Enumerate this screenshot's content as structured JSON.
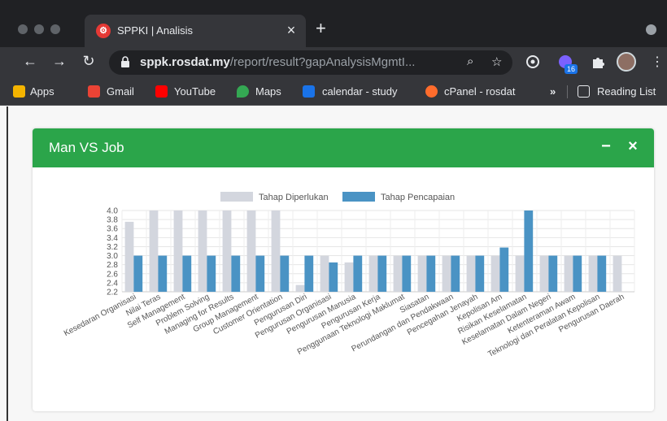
{
  "browser": {
    "tab": {
      "title": "SPPKI | Analisis",
      "favicon_letter": "⚙",
      "close": "×"
    },
    "new_tab": "+",
    "nav": {
      "back": "←",
      "forward": "→",
      "reload": "↻"
    },
    "address": {
      "host": "sppk.rosdat.my",
      "path": "/report/result?gapAnalysisMgmtI..."
    },
    "extension_badge": "16",
    "menu": "⋮",
    "bookmarks": [
      {
        "label": "Apps",
        "icon": "apps-grid-icon",
        "color": "#f4b400"
      },
      {
        "label": "Gmail",
        "icon": "gmail-icon",
        "color": "#ea4335"
      },
      {
        "label": "YouTube",
        "icon": "youtube-icon",
        "color": "#ff0000"
      },
      {
        "label": "Maps",
        "icon": "maps-pin-icon",
        "color": "#34a853"
      },
      {
        "label": "calendar - study",
        "icon": "calendar-icon",
        "color": "#1a73e8"
      },
      {
        "label": "cPanel - rosdat",
        "icon": "cpanel-icon",
        "color": "#ff6c2c"
      }
    ],
    "bookmarks_overflow": "»",
    "reading_list": "Reading List"
  },
  "card": {
    "title": "Man VS Job",
    "minimize": "−",
    "close": "×",
    "header_color": "#2ba54a"
  },
  "chart_data": {
    "type": "bar",
    "legend_position": "top",
    "ylim": [
      2.2,
      4.0
    ],
    "yticks": [
      "4.0",
      "3.8",
      "3.6",
      "3.4",
      "3.2",
      "3.0",
      "2.8",
      "2.6",
      "2.4",
      "2.2"
    ],
    "grid": true,
    "categories": [
      "Kesedaran Organisasi",
      "Nilai Teras",
      "Self Management",
      "Problem Solving",
      "Managing for Results",
      "Group Management",
      "Customer Orientation",
      "Pengurusan Diri",
      "Pengurusan Organisasi",
      "Pengurusan Manusia",
      "Pengurusan Kerja",
      "Penggunaan Teknologi Maklumat",
      "Siasatan",
      "Perundangan dan Pendakwaan",
      "Pencegahan Jenayah",
      "Kepolisan Am",
      "Risikan Keselamatan",
      "Keselamatan Dalam Negeri",
      "Ketenteraman Awam",
      "Teknologi dan Peralatan Kepolisan",
      "Pengurusan Daerah"
    ],
    "series": [
      {
        "name": "Tahap Diperlukan",
        "color": "#d3d6de",
        "values": [
          3.75,
          4.0,
          4.0,
          4.0,
          4.0,
          4.0,
          4.0,
          2.35,
          3.0,
          2.85,
          3.0,
          3.0,
          3.0,
          3.0,
          3.0,
          3.0,
          3.0,
          3.0,
          3.0,
          3.0,
          3.0
        ]
      },
      {
        "name": "Tahap Pencapaian",
        "color": "#4a93c4",
        "values": [
          3.0,
          3.0,
          3.0,
          3.0,
          3.0,
          3.0,
          3.0,
          3.0,
          2.85,
          3.0,
          3.0,
          3.0,
          3.0,
          3.0,
          3.0,
          3.18,
          4.0,
          3.0,
          3.0,
          3.0,
          null
        ]
      }
    ]
  }
}
